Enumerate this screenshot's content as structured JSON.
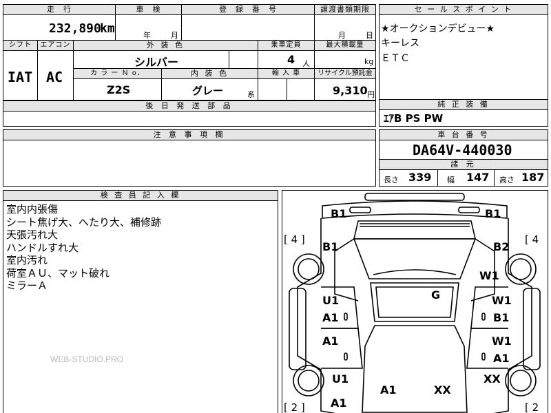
{
  "header": {
    "mileage_label": "走　行",
    "inspection_label": "車　検",
    "registration_label": "登　録　番　号",
    "transfer_label": "譲渡書類期限",
    "sales_points_label": "セ ー ル ス ポ イ ン ト",
    "mileage_value": "232,890",
    "mileage_unit": "km",
    "year_unit": "年",
    "month_unit": "月",
    "transfer_month_unit": "月",
    "transfer_day_unit": "日"
  },
  "row2": {
    "shift_label": "シフト",
    "aircon_label": "エアコン",
    "exterior_label": "外 装 色",
    "capacity_label": "乗車定員",
    "maxload_label": "最大積載量",
    "shift_value": "IAT",
    "aircon_value": "AC",
    "exterior_value": "シルバー",
    "capacity_value": "4",
    "capacity_unit": "人",
    "maxload_unit": "kg",
    "color_no_label": "カ ラ ー Ｎ o．",
    "interior_label": "内 装 色",
    "import_label": "輸 入 車",
    "recycle_label": "リサイクル預託金",
    "color_no_value": "Z2S",
    "interior_value": "グレー",
    "interior_suffix": "系",
    "recycle_value": "9,310",
    "recycle_unit": "円",
    "later_parts_label": "後 日 発 送 部 品"
  },
  "sales_points": [
    "★オークションデビュー★",
    "キーレス",
    "ＥＴＣ"
  ],
  "equipment": {
    "label": "純 正 装 備",
    "value": "ｴｱB PS PW"
  },
  "notes": {
    "label": "注 意 事 項 欄"
  },
  "chassis": {
    "label": "車 台 番 号",
    "value": "DA64V-440030",
    "spec_label": "諸 元",
    "length_label": "長さ",
    "length_value": "339",
    "width_label": "幅",
    "width_value": "147",
    "height_label": "高さ",
    "height_value": "187"
  },
  "inspector": {
    "label": "検 査 員 記 入 欄",
    "remarks": [
      "室内内張傷",
      "シート焦げ大、へたり大、補修跡",
      "天張汚れ大",
      "ハンドルすれ大",
      "室内汚れ",
      "荷室ＡＵ、マット破れ",
      "ミラーＡ"
    ],
    "watermark": "WEB-STUDIO.PRO"
  },
  "diagram": {
    "marks": {
      "front_left": "B1",
      "front_right": "B1",
      "left_upper": "B1",
      "right_upper": "B2",
      "right_w1": "W1",
      "roof": "G",
      "left_door_front_a": "U1",
      "left_door_front_b": "A1",
      "right_door_front_a": "W1",
      "right_door_front_b": "B1",
      "left_door_rear": "A1",
      "right_door_rear_a": "W1",
      "right_door_rear_b": "A1",
      "left_rear_quarter": "U1",
      "right_rear_quarter": "XX",
      "rear_left": "A1",
      "rear_right": "XX",
      "left_bottom": "A1"
    },
    "tire_front_left": "[ 4 ]",
    "tire_front_right": "[ 4",
    "tire_rear_left": "[ 2 ]",
    "tire_rear_right": "[ 2"
  }
}
